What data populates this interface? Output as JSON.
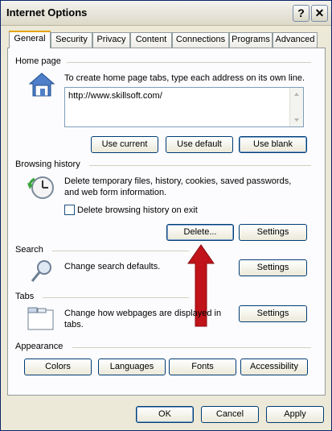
{
  "window": {
    "title": "Internet Options",
    "help_glyph": "?",
    "close_glyph": "✕"
  },
  "tabs": [
    {
      "label": "General"
    },
    {
      "label": "Security"
    },
    {
      "label": "Privacy"
    },
    {
      "label": "Content"
    },
    {
      "label": "Connections"
    },
    {
      "label": "Programs"
    },
    {
      "label": "Advanced"
    }
  ],
  "home_page": {
    "group_label": "Home page",
    "description": "To create home page tabs, type each address on its own line.",
    "url": "http://www.skillsoft.com/",
    "use_current": "Use current",
    "use_default": "Use default",
    "use_blank": "Use blank"
  },
  "browsing_history": {
    "group_label": "Browsing history",
    "description_1": "Delete temporary files, history, cookies, saved passwords,",
    "description_2": "and web form information.",
    "checkbox_label": "Delete browsing history on exit",
    "checked": false,
    "delete_button": "Delete...",
    "settings_button": "Settings"
  },
  "search": {
    "group_label": "Search",
    "description": "Change search defaults.",
    "settings_button": "Settings"
  },
  "tabs_section": {
    "group_label": "Tabs",
    "description_1": "Change how webpages are displayed in",
    "description_2": "tabs.",
    "settings_button": "Settings"
  },
  "appearance": {
    "group_label": "Appearance",
    "colors": "Colors",
    "languages": "Languages",
    "fonts": "Fonts",
    "accessibility": "Accessibility"
  },
  "footer": {
    "ok": "OK",
    "cancel": "Cancel",
    "apply": "Apply"
  },
  "colors": {
    "annotation_arrow": "#c0141a",
    "tab_highlight": "#e6a400",
    "button_border": "#003c74"
  }
}
